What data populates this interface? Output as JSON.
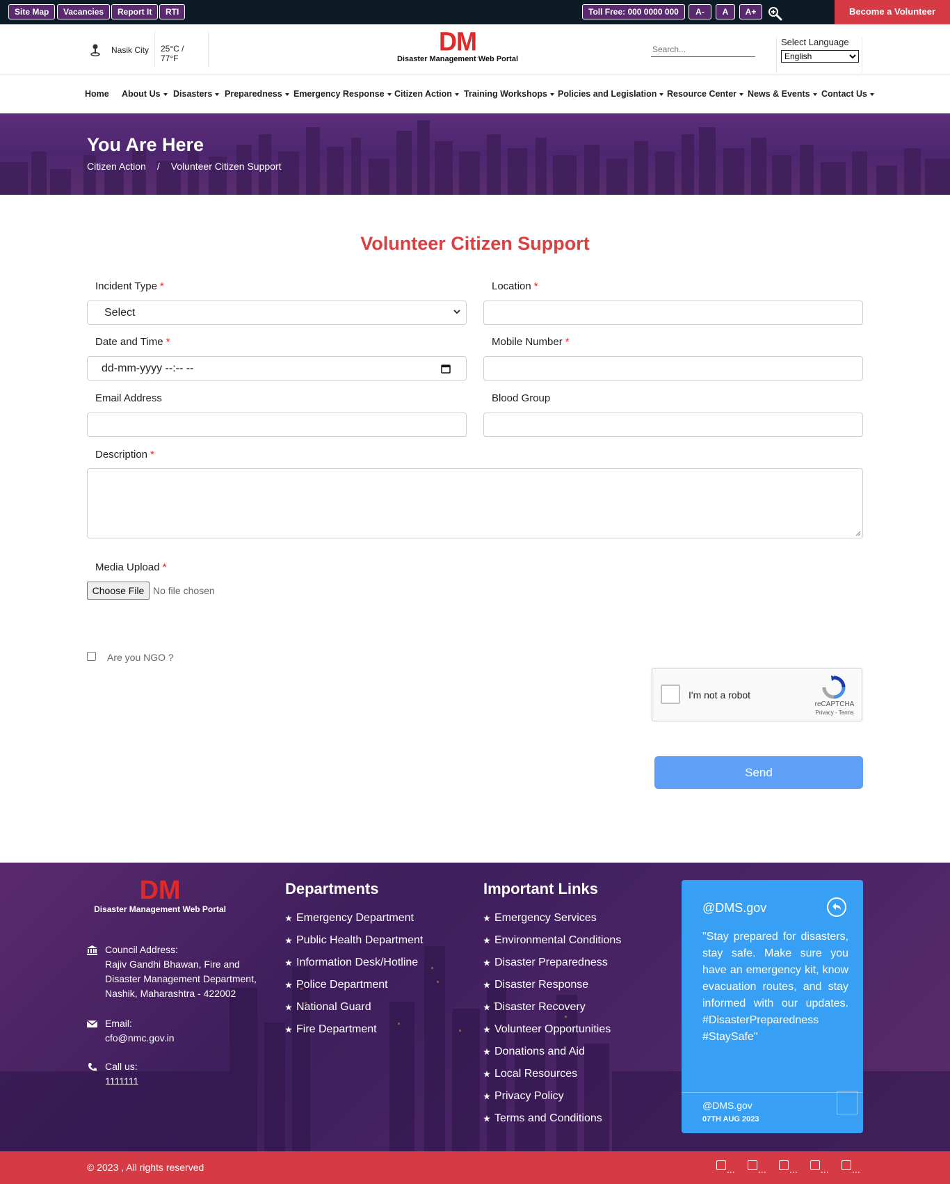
{
  "topbar": {
    "left_links": [
      "Site Map",
      "Vacancies",
      "Report It",
      "RTI"
    ],
    "toll_free": "Toll Free: 000 0000 000",
    "font_controls": [
      "A-",
      "A",
      "A+"
    ],
    "zoom_icon": "zoom-in-icon",
    "volunteer_button": "Become a Volunteer"
  },
  "header": {
    "location": "Nasik City",
    "weather": "25°C / 77°F",
    "logo_mark": "DM",
    "logo_text": "Disaster Management Web Portal",
    "search_placeholder": "Search...",
    "language_label": "Select Language",
    "language_value": "English"
  },
  "nav": {
    "items": [
      {
        "label": "Home",
        "caret": false
      },
      {
        "label": "About Us",
        "caret": true
      },
      {
        "label": "Disasters",
        "caret": true
      },
      {
        "label": "Preparedness",
        "caret": true
      },
      {
        "label": "Emergency Response",
        "caret": true
      },
      {
        "label": "Citizen Action",
        "caret": true
      },
      {
        "label": "Training Workshops",
        "caret": true
      },
      {
        "label": "Policies and Legislation",
        "caret": true
      },
      {
        "label": "Resource Center",
        "caret": true
      },
      {
        "label": "News & Events",
        "caret": true
      },
      {
        "label": "Contact Us",
        "caret": true
      }
    ]
  },
  "banner": {
    "heading": "You Are Here",
    "breadcrumb": [
      "Citizen Action",
      "Volunteer Citizen Support"
    ],
    "separator": "/"
  },
  "form": {
    "title": "Volunteer Citizen Support",
    "required_mark": "*",
    "incident_type": {
      "label": "Incident Type",
      "value": "Select"
    },
    "location": {
      "label": "Location",
      "value": ""
    },
    "date_time": {
      "label": "Date and Time",
      "value": "dd-mm-yyyy --:-- --"
    },
    "mobile": {
      "label": "Mobile Number",
      "value": ""
    },
    "email": {
      "label": "Email Address",
      "value": ""
    },
    "blood_group": {
      "label": "Blood Group",
      "value": ""
    },
    "description": {
      "label": "Description",
      "value": ""
    },
    "media_upload": {
      "label": "Media Upload",
      "button": "Choose File",
      "status": "No file chosen"
    },
    "ngo_label": "Are you NGO ?",
    "captcha": {
      "text": "I'm not a robot",
      "brand": "reCAPTCHA",
      "links": "Privacy - Terms"
    },
    "send": "Send"
  },
  "footer": {
    "logo_mark": "DM",
    "logo_text": "Disaster Management Web Portal",
    "address_label": "Council Address:",
    "address_lines": [
      "Rajiv Gandhi Bhawan, Fire and",
      "Disaster Management Department,",
      "Nashik, Maharashtra - 422002"
    ],
    "email_label": "Email:",
    "email": "cfo@nmc.gov.in",
    "call_label": "Call us:",
    "phone": "1111111",
    "departments_title": "Departments",
    "departments": [
      "Emergency Department",
      "Public Health Department",
      "Information Desk/Hotline",
      "Police Department",
      "National Guard",
      "Fire Department"
    ],
    "links_title": "Important Links",
    "links": [
      "Emergency Services",
      "Environmental Conditions",
      "Disaster Preparedness",
      "Disaster Response",
      "Disaster Recovery",
      "Volunteer Opportunities",
      "Donations and Aid",
      "Local Resources",
      "Privacy Policy",
      "Terms and Conditions"
    ],
    "tweet": {
      "handle": "@DMS.gov",
      "text": "\"Stay prepared for disasters, stay safe. Make sure you have an emergency kit, know evacuation routes, and stay informed with our updates. #DisasterPreparedness #StaySafe\"",
      "by": "@DMS.gov",
      "date": "07TH AUG 2023"
    },
    "copyright": "© 2023 , All rights reserved",
    "social_icons": [
      "broken-image-icon",
      "broken-image-icon",
      "broken-image-icon",
      "broken-image-icon",
      "broken-image-icon"
    ],
    "social_placeholder": "..."
  },
  "colors": {
    "accent_red": "#d63a44",
    "title_red": "#d9403f",
    "purple": "#5a2a6e",
    "send_blue": "#5ea0f8",
    "tweet_blue": "#37a0f4",
    "topbar_dark": "#0d1b26"
  }
}
